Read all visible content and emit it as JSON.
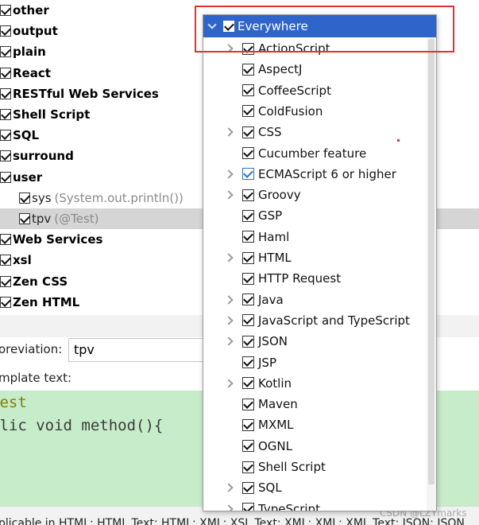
{
  "template_groups": [
    {
      "label": "other"
    },
    {
      "label": "output"
    },
    {
      "label": "plain"
    },
    {
      "label": "React"
    },
    {
      "label": "RESTful Web Services"
    },
    {
      "label": "Shell Script"
    },
    {
      "label": "SQL"
    },
    {
      "label": "surround"
    },
    {
      "label": "user"
    }
  ],
  "user_children": [
    {
      "label": "sys",
      "desc": "(System.out.println())"
    },
    {
      "label": "tpv",
      "desc": "(@Test)"
    }
  ],
  "template_groups_after": [
    {
      "label": "Web Services"
    },
    {
      "label": "xsl"
    },
    {
      "label": "Zen CSS"
    },
    {
      "label": "Zen HTML"
    }
  ],
  "abbreviation": {
    "label": "oreviation:",
    "value": "tpv"
  },
  "template_text": {
    "label": "mplate text:",
    "lines": [
      "Test",
      "blic void method(){"
    ]
  },
  "applicable_text": "plicable in HTML: HTML Text; HTML; XML; XSL Text; XML; XML; XML Text; JSON; JSON",
  "watermark": "CSDN @LZYmarks",
  "context_popup": {
    "header": "Everywhere",
    "items": [
      {
        "label": "ActionScript",
        "expandable": true
      },
      {
        "label": "AspectJ",
        "expandable": false
      },
      {
        "label": "CoffeeScript",
        "expandable": false
      },
      {
        "label": "ColdFusion",
        "expandable": false
      },
      {
        "label": "CSS",
        "expandable": true
      },
      {
        "label": "Cucumber feature",
        "expandable": false
      },
      {
        "label": "ECMAScript 6 or higher",
        "expandable": true,
        "accent": true
      },
      {
        "label": "Groovy",
        "expandable": true
      },
      {
        "label": "GSP",
        "expandable": false
      },
      {
        "label": "Haml",
        "expandable": false
      },
      {
        "label": "HTML",
        "expandable": true
      },
      {
        "label": "HTTP Request",
        "expandable": false
      },
      {
        "label": "Java",
        "expandable": true
      },
      {
        "label": "JavaScript and TypeScript",
        "expandable": true
      },
      {
        "label": "JSON",
        "expandable": true
      },
      {
        "label": "JSP",
        "expandable": false
      },
      {
        "label": "Kotlin",
        "expandable": true
      },
      {
        "label": "Maven",
        "expandable": false
      },
      {
        "label": "MXML",
        "expandable": false
      },
      {
        "label": "OGNL",
        "expandable": false
      },
      {
        "label": "Shell Script",
        "expandable": false
      },
      {
        "label": "SQL",
        "expandable": true
      },
      {
        "label": "TypeScript",
        "expandable": true
      }
    ]
  },
  "colors": {
    "selection_header": "#2f65ca",
    "editor_background": "#c7ecc9",
    "highlight_box": "#e53030",
    "checkbox_accent": "#2675bf"
  }
}
